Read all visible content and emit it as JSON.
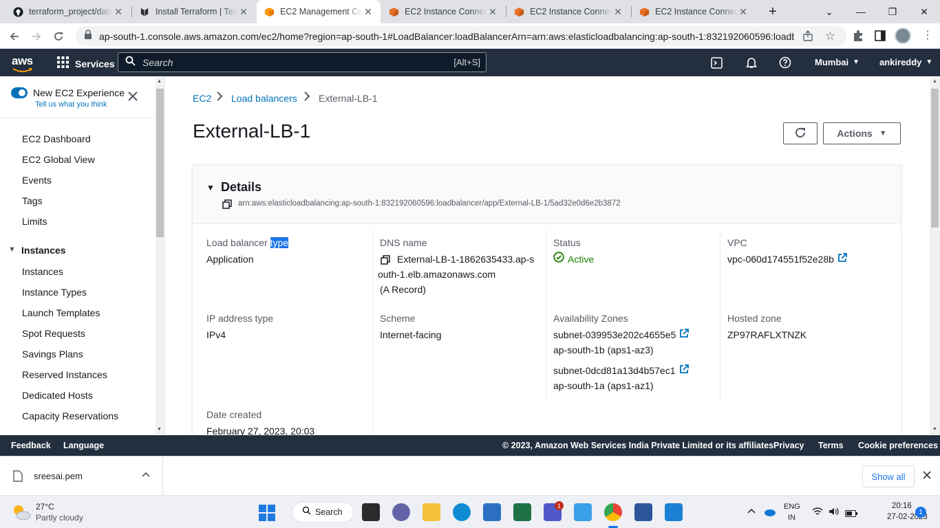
{
  "browser": {
    "tabs": [
      {
        "label": "terraform_project/data",
        "icon": "github-icon"
      },
      {
        "label": "Install Terraform | Terr",
        "icon": "terraform-icon"
      },
      {
        "label": "EC2 Management Con",
        "icon": "aws-cube-icon"
      },
      {
        "label": "EC2 Instance Connect",
        "icon": "aws-cube-icon"
      },
      {
        "label": "EC2 Instance Connect",
        "icon": "aws-cube-icon"
      },
      {
        "label": "EC2 Instance Connect",
        "icon": "aws-cube-icon"
      }
    ],
    "url": "ap-south-1.console.aws.amazon.com/ec2/home?region=ap-south-1#LoadBalancer:loadBalancerArn=arn:aws:elasticloadbalancing:ap-south-1:832192060596:loadb..."
  },
  "awsnav": {
    "logo": "aws",
    "services": "Services",
    "search_placeholder": "Search",
    "search_shortcut": "[Alt+S]",
    "region": "Mumbai",
    "user": "ankireddy"
  },
  "sidebar": {
    "new_exp": "New EC2 Experience",
    "feedback": "Tell us what you think",
    "items": [
      "EC2 Dashboard",
      "EC2 Global View",
      "Events",
      "Tags",
      "Limits"
    ],
    "section": "Instances",
    "section_items": [
      "Instances",
      "Instance Types",
      "Launch Templates",
      "Spot Requests",
      "Savings Plans",
      "Reserved Instances",
      "Dedicated Hosts",
      "Capacity Reservations"
    ]
  },
  "breadcrumb": {
    "c1": "EC2",
    "c2": "Load balancers",
    "c3": "External-LB-1"
  },
  "page": {
    "title": "External-LB-1",
    "actions": "Actions"
  },
  "details": {
    "heading": "Details",
    "arn": "arn:aws:elasticloadbalancing:ap-south-1:832192060596:loadbalancer/app/External-LB-1/5ad32e0d6e2b3872",
    "lb_type_label_a": "Load balancer ",
    "lb_type_label_b": "type",
    "lb_type": "Application",
    "dns_label": "DNS name",
    "dns_line1": "External-LB-1-1862635433.ap-s",
    "dns_line2": "outh-1.elb.amazonaws.com",
    "dns_line3": "(A Record)",
    "status_label": "Status",
    "status": "Active",
    "vpc_label": "VPC",
    "vpc": "vpc-060d174551f52e28b",
    "ip_label": "IP address type",
    "ip": "IPv4",
    "scheme_label": "Scheme",
    "scheme": "Internet-facing",
    "az_label": "Availability Zones",
    "az1_subnet": "subnet-039953e202c4655e5",
    "az1_zone": "ap-south-1b (aps1-az3)",
    "az2_subnet": "subnet-0dcd81a13d4b57ec1",
    "az2_zone": "ap-south-1a (aps1-az1)",
    "hz_label": "Hosted zone",
    "hz": "ZP97RAFLXTNZK",
    "date_label": "Date created",
    "date": "February 27, 2023, 20:03"
  },
  "footer": {
    "feedback": "Feedback",
    "language": "Language",
    "copyright": "© 2023, Amazon Web Services India Private Limited or its affiliates.",
    "privacy": "Privacy",
    "terms": "Terms",
    "cookies": "Cookie preferences"
  },
  "download": {
    "file": "sreesai.pem",
    "show_all": "Show all"
  },
  "taskbar": {
    "temp": "27°C",
    "weather": "Partly cloudy",
    "search": "Search",
    "lang1": "ENG",
    "lang2": "IN",
    "time": "20:16",
    "date": "27-02-2023",
    "notif": "1",
    "teams_badge": "1"
  },
  "colors": {
    "aws_nav": "#232f3e",
    "link": "#0073bb",
    "success": "#1d8102",
    "aws_orange": "#ff9900"
  }
}
